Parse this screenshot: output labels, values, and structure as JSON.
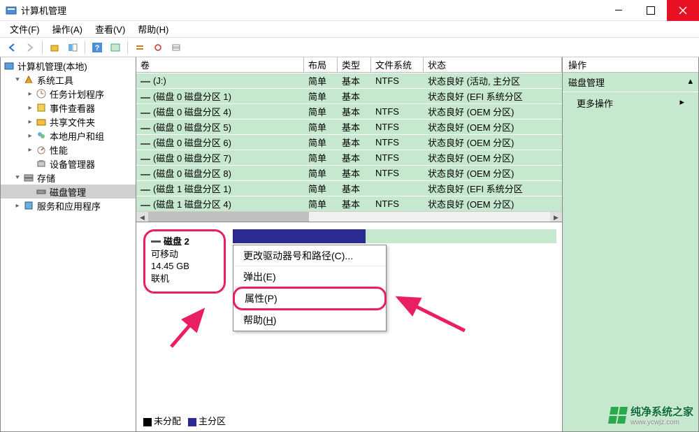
{
  "title": "计算机管理",
  "menus": [
    "文件(F)",
    "操作(A)",
    "查看(V)",
    "帮助(H)"
  ],
  "tree": {
    "root": "计算机管理(本地)",
    "sys_tools": "系统工具",
    "task_scheduler": "任务计划程序",
    "event_viewer": "事件查看器",
    "shared_folders": "共享文件夹",
    "local_users": "本地用户和组",
    "performance": "性能",
    "device_mgr": "设备管理器",
    "storage": "存储",
    "disk_mgmt": "磁盘管理",
    "services": "服务和应用程序"
  },
  "vol_headers": {
    "volume": "卷",
    "layout": "布局",
    "type": "类型",
    "fs": "文件系统",
    "status": "状态"
  },
  "volumes": [
    {
      "name": "(J:)",
      "layout": "简单",
      "type": "基本",
      "fs": "NTFS",
      "status": "状态良好 (活动, 主分区"
    },
    {
      "name": "(磁盘 0 磁盘分区 1)",
      "layout": "简单",
      "type": "基本",
      "fs": "",
      "status": "状态良好 (EFI 系统分区"
    },
    {
      "name": "(磁盘 0 磁盘分区 4)",
      "layout": "简单",
      "type": "基本",
      "fs": "NTFS",
      "status": "状态良好 (OEM 分区)"
    },
    {
      "name": "(磁盘 0 磁盘分区 5)",
      "layout": "简单",
      "type": "基本",
      "fs": "NTFS",
      "status": "状态良好 (OEM 分区)"
    },
    {
      "name": "(磁盘 0 磁盘分区 6)",
      "layout": "简单",
      "type": "基本",
      "fs": "NTFS",
      "status": "状态良好 (OEM 分区)"
    },
    {
      "name": "(磁盘 0 磁盘分区 7)",
      "layout": "简单",
      "type": "基本",
      "fs": "NTFS",
      "status": "状态良好 (OEM 分区)"
    },
    {
      "name": "(磁盘 0 磁盘分区 8)",
      "layout": "简单",
      "type": "基本",
      "fs": "NTFS",
      "status": "状态良好 (OEM 分区)"
    },
    {
      "name": "(磁盘 1 磁盘分区 1)",
      "layout": "简单",
      "type": "基本",
      "fs": "",
      "status": "状态良好 (EFI 系统分区"
    },
    {
      "name": "(磁盘 1 磁盘分区 4)",
      "layout": "简单",
      "type": "基本",
      "fs": "NTFS",
      "status": "状态良好 (OEM 分区)"
    }
  ],
  "disk": {
    "title": "磁盘 2",
    "line1": "可移动",
    "line2": "14.45 GB",
    "line3": "联机"
  },
  "context": {
    "change": "更改驱动器号和路径(C)...",
    "eject": "弹出(E)",
    "properties": "属性(P)",
    "help": "帮助(H)"
  },
  "legend": {
    "unalloc": "未分配",
    "primary": "主分区"
  },
  "actions": {
    "header": "操作",
    "title": "磁盘管理",
    "more": "更多操作"
  },
  "watermark": {
    "brand": "纯净系统之家",
    "url": "www.ycwjz.com"
  }
}
